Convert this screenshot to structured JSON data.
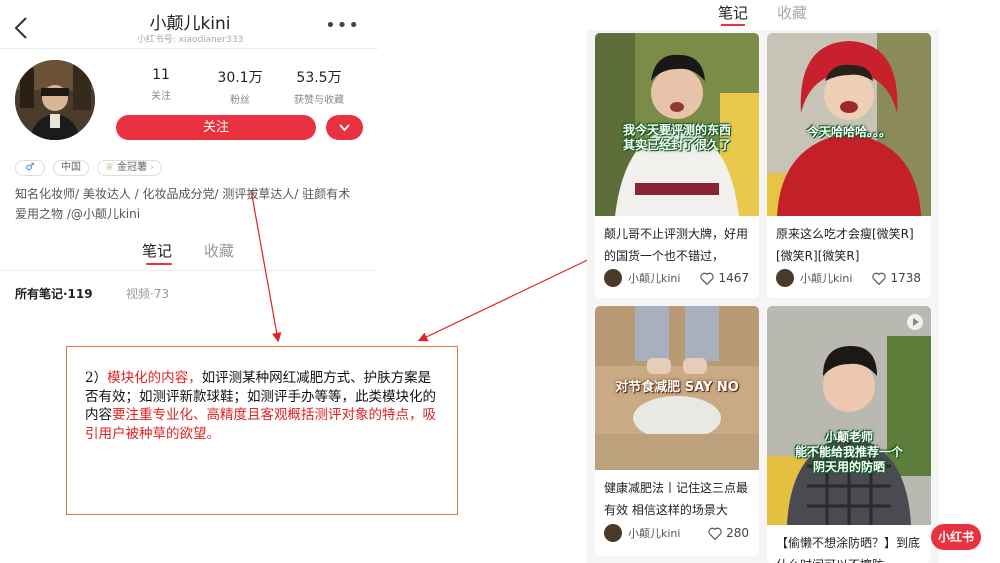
{
  "profile": {
    "name": "小颠儿kini",
    "xhs_id": "小红书号: xiaodianer333",
    "stats": [
      {
        "value": "11",
        "label": "关注"
      },
      {
        "value": "30.1万",
        "label": "粉丝"
      },
      {
        "value": "53.5万",
        "label": "获赞与收藏"
      }
    ],
    "follow_label": "关注",
    "tags": {
      "gender": "♂",
      "region": "中国",
      "badge": "金冠薯"
    },
    "bio": "知名化妆师/ 美妆达人 / 化妆品成分党/ 测评拔草达人/ 驻颜有术 爱用之物 /@小颠儿kini",
    "tabs": {
      "notes": "笔记",
      "favorites": "收藏"
    },
    "filters": {
      "all": "所有笔记·119",
      "video": "视频·73"
    }
  },
  "annotation": {
    "prefix": "2）",
    "red1": "模块化的内容，",
    "black1": "如评测某种网红减肥方式、护肤方案是否有效；如测评新款球鞋；如测评手办等等，此类模块化的内容",
    "red2": "要注重专业化、高精度且客观概括测评对象的特点，吸引用户被种草的欲望。"
  },
  "feed": {
    "tabs": {
      "notes": "笔记",
      "favorites": "收藏"
    },
    "cards": [
      {
        "overlay": "我今天要评测的东西\n其实已经封了很久了",
        "title": "颠儿哥不止评测大牌，好用的国货一个也不错过，",
        "author": "小颠儿kini",
        "likes": "1467"
      },
      {
        "overlay": "今天哈哈哈。。。",
        "title": "原来这么吃才会瘦[微笑R][微笑R][微笑R]",
        "author": "小颠儿kini",
        "likes": "1738"
      },
      {
        "overlay": "对节食减肥 SAY NO",
        "title": "健康减肥法丨记住这三点最有效 相信这样的场景大",
        "author": "小颠儿kini",
        "likes": "280"
      },
      {
        "overlay": "小颠老师\n能不能给我推荐一个\n阴天用的防晒",
        "title": "【偷懒不想涂防晒？】到底什么时间可以不擦防",
        "author": "",
        "likes": ""
      }
    ]
  },
  "badge": "小红书",
  "colors": {
    "accent": "#e8323f",
    "annotation_border": "#e07b3c",
    "annotation_red": "#e02222"
  }
}
